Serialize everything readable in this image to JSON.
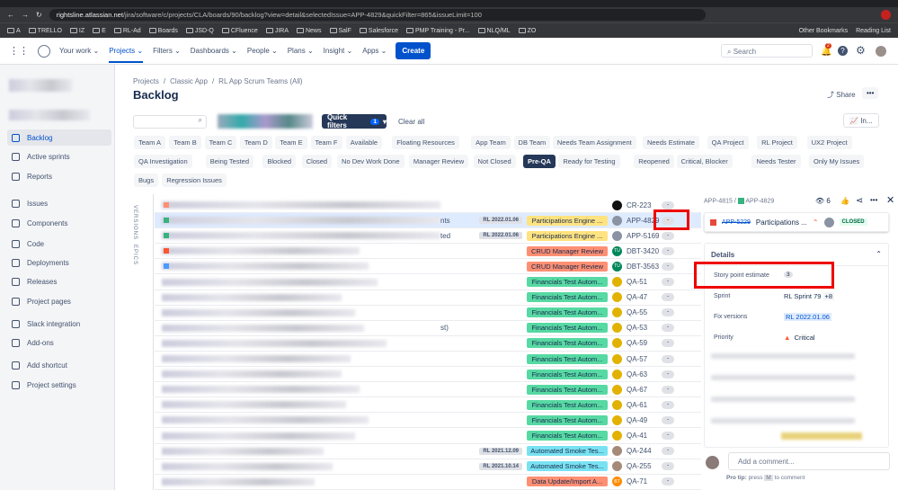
{
  "browser": {
    "url_host": "rightsline.atlassian.net",
    "url_path": "/jira/software/c/projects/CLA/boards/90/backlog?view=detail&selectedIssue=APP-4829&quickFilter=865&issueLimit=100",
    "bookmarks": [
      "A",
      "TRELLO",
      "IZ",
      "E",
      "RL-Ad",
      "Boards",
      "JSD-Q",
      "CFluence",
      "JIRA",
      "News",
      "SalF",
      "Salesforce",
      "PMP Training - Pr...",
      "NLQ/ML",
      "ZO"
    ],
    "other_bookmarks": "Other Bookmarks",
    "reading_list": "Reading List"
  },
  "nav": {
    "items": [
      "Your work",
      "Projects",
      "Filters",
      "Dashboards",
      "People",
      "Plans",
      "Insight",
      "Apps"
    ],
    "create": "Create",
    "search_placeholder": "Search",
    "notif_count": "2"
  },
  "sidebar": {
    "items": [
      "Backlog",
      "Active sprints",
      "Reports",
      "Issues",
      "Components",
      "Code",
      "Deployments",
      "Releases",
      "Project pages",
      "Slack integration",
      "Add-ons",
      "Add shortcut",
      "Project settings"
    ]
  },
  "breadcrumb": [
    "Projects",
    "Classic App",
    "RL App Scrum Teams (All)"
  ],
  "title": "Backlog",
  "share": "Share",
  "insights": "In...",
  "quick_filters": {
    "label": "Quick filters",
    "count": "1",
    "clear": "Clear all"
  },
  "chips": [
    [
      "Team A",
      "Team B",
      "Team C",
      "Team D",
      "Team E",
      "Team F",
      "Available",
      "Floating Resources",
      "App Team",
      "DB Team",
      "Needs Team Assignment",
      "Needs Estimate",
      "QA Project",
      "RL Project",
      "UX2 Project"
    ],
    [
      "QA Investigation",
      "Being Tested",
      "Blocked",
      "Closed",
      "No Dev Work Done",
      "Manager Review",
      "Not Closed",
      "Pre-QA",
      "Ready for Testing",
      "Reopened",
      "Critical, Blocker",
      "Needs Tester",
      "Only My Issues"
    ],
    [
      "Bugs",
      "Regression Issues"
    ]
  ],
  "active_chip": "Pre-QA",
  "side_tabs": [
    "VERSIONS",
    "EPICS"
  ],
  "rows": [
    {
      "frag": "",
      "ver": "",
      "epic": "",
      "color": "",
      "key": "CR-223",
      "pri": "high",
      "av": "#111",
      "avt": ""
    },
    {
      "frag": "nts",
      "ver": "RL 2022.01.06",
      "epic": "Participations Engine ...",
      "color": "#ffe380",
      "key": "APP-4829",
      "pri": "high",
      "av": "#8993a4",
      "avt": ""
    },
    {
      "frag": "ted",
      "ver": "RL 2022.01.06",
      "epic": "Participations Engine ...",
      "color": "#ffe380",
      "key": "APP-5169",
      "pri": "high",
      "av": "#8993a4",
      "avt": ""
    },
    {
      "frag": "",
      "ver": "",
      "epic": "CRUD Manager Review",
      "color": "#ff8f73",
      "key": "DBT-3420",
      "pri": "high",
      "av": "#00875a",
      "avt": "TU"
    },
    {
      "frag": "",
      "ver": "",
      "epic": "CRUD Manager Review",
      "color": "#ff8f73",
      "key": "DBT-3563",
      "pri": "low",
      "av": "#00875a",
      "avt": "TU"
    },
    {
      "frag": "",
      "ver": "",
      "epic": "Financials Test Autom...",
      "color": "#57d9a3",
      "key": "QA-51",
      "pri": "low",
      "av": "#e2b203",
      "avt": ""
    },
    {
      "frag": "",
      "ver": "",
      "epic": "Financials Test Autom...",
      "color": "#57d9a3",
      "key": "QA-47",
      "pri": "low",
      "av": "#e2b203",
      "avt": ""
    },
    {
      "frag": "",
      "ver": "",
      "epic": "Financials Test Autom...",
      "color": "#57d9a3",
      "key": "QA-55",
      "pri": "low",
      "av": "#e2b203",
      "avt": ""
    },
    {
      "frag": "st)",
      "ver": "",
      "epic": "Financials Test Autom...",
      "color": "#57d9a3",
      "key": "QA-53",
      "pri": "low",
      "av": "#e2b203",
      "avt": ""
    },
    {
      "frag": "",
      "ver": "",
      "epic": "Financials Test Autom...",
      "color": "#57d9a3",
      "key": "QA-59",
      "pri": "low",
      "av": "#e2b203",
      "avt": ""
    },
    {
      "frag": "",
      "ver": "",
      "epic": "Financials Test Autom...",
      "color": "#57d9a3",
      "key": "QA-57",
      "pri": "low",
      "av": "#e2b203",
      "avt": ""
    },
    {
      "frag": "",
      "ver": "",
      "epic": "Financials Test Autom...",
      "color": "#57d9a3",
      "key": "QA-63",
      "pri": "low",
      "av": "#e2b203",
      "avt": ""
    },
    {
      "frag": "",
      "ver": "",
      "epic": "Financials Test Autom...",
      "color": "#57d9a3",
      "key": "QA-67",
      "pri": "low",
      "av": "#e2b203",
      "avt": ""
    },
    {
      "frag": "",
      "ver": "",
      "epic": "Financials Test Autom...",
      "color": "#57d9a3",
      "key": "QA-61",
      "pri": "low",
      "av": "#e2b203",
      "avt": ""
    },
    {
      "frag": "",
      "ver": "",
      "epic": "Financials Test Autom...",
      "color": "#57d9a3",
      "key": "QA-49",
      "pri": "low",
      "av": "#e2b203",
      "avt": ""
    },
    {
      "frag": "",
      "ver": "",
      "epic": "Financials Test Autom...",
      "color": "#57d9a3",
      "key": "QA-41",
      "pri": "low",
      "av": "#e2b203",
      "avt": ""
    },
    {
      "frag": "",
      "ver": "RL 2021.12.09",
      "epic": "Automated Smoke Tes...",
      "color": "#79e2f2",
      "key": "QA-244",
      "pri": "low",
      "av": "#a58a7a",
      "avt": ""
    },
    {
      "frag": "",
      "ver": "RL 2021.10.14",
      "epic": "Automated Smoke Tes...",
      "color": "#79e2f2",
      "key": "QA-255",
      "pri": "low",
      "av": "#a58a7a",
      "avt": ""
    },
    {
      "frag": "",
      "ver": "",
      "epic": "Data Update/Import A...",
      "color": "#ff8f73",
      "key": "QA-71",
      "pri": "low",
      "av": "#ff8b00",
      "avt": "BT"
    }
  ],
  "estimate_placeholder": "-",
  "panel": {
    "parent": "APP-4815",
    "key": "APP-4829",
    "watchers": "6",
    "linked_key": "APP-5229",
    "linked_summary": "Participations ...",
    "linked_status": "CLOSED",
    "details_title": "Details",
    "fields": [
      {
        "label": "Story point estimate",
        "value": "3"
      },
      {
        "label": "Sprint",
        "value": "RL Sprint 79",
        "extra": "+8"
      },
      {
        "label": "Fix versions",
        "value": "RL 2022.01.06"
      },
      {
        "label": "Priority",
        "value": "Critical"
      }
    ],
    "comment_placeholder": "Add a comment...",
    "pro_tip": "Pro tip:",
    "pro_tip_text": "press",
    "pro_tip_key": "M",
    "pro_tip_end": "to comment"
  }
}
